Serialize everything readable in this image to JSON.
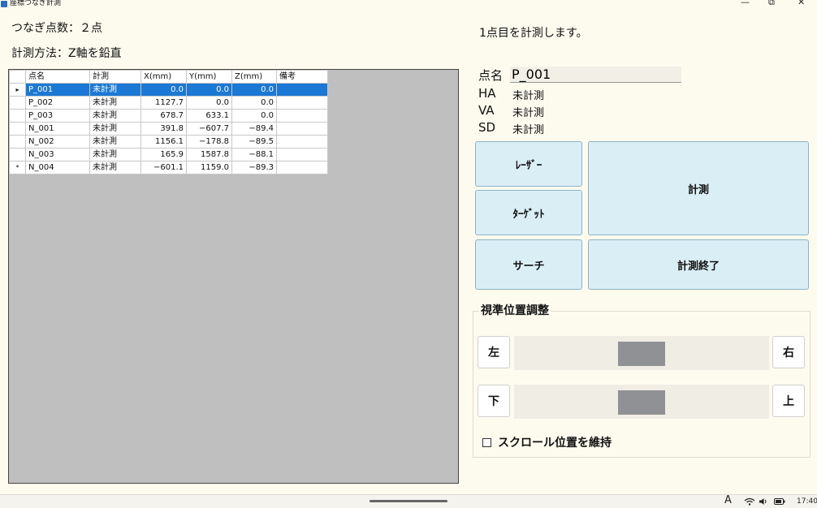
{
  "window": {
    "title": "座標つなぎ計測",
    "minimize": "—",
    "maximize": "⧉",
    "close": "✕"
  },
  "info": {
    "count_text": "つなぎ点数：２点",
    "method_text": "計測方法：Z軸を鉛直"
  },
  "status": "1点目を計測します。",
  "grid": {
    "columns": [
      "点名",
      "計測",
      "X(mm)",
      "Y(mm)",
      "Z(mm)",
      "備考"
    ],
    "rows": [
      {
        "marker": "▸",
        "name": "P_001",
        "state": "未計測",
        "x": "0.0",
        "y": "0.0",
        "z": "0.0",
        "note": ""
      },
      {
        "marker": "",
        "name": "P_002",
        "state": "未計測",
        "x": "1127.7",
        "y": "0.0",
        "z": "0.0",
        "note": ""
      },
      {
        "marker": "",
        "name": "P_003",
        "state": "未計測",
        "x": "678.7",
        "y": "633.1",
        "z": "0.0",
        "note": ""
      },
      {
        "marker": "",
        "name": "N_001",
        "state": "未計測",
        "x": "391.8",
        "y": "−607.7",
        "z": "−89.4",
        "note": ""
      },
      {
        "marker": "",
        "name": "N_002",
        "state": "未計測",
        "x": "1156.1",
        "y": "−178.8",
        "z": "−89.5",
        "note": ""
      },
      {
        "marker": "",
        "name": "N_003",
        "state": "未計測",
        "x": "165.9",
        "y": "1587.8",
        "z": "−88.1",
        "note": ""
      },
      {
        "marker": "*",
        "name": "N_004",
        "state": "未計測",
        "x": "−601.1",
        "y": "1159.0",
        "z": "−89.3",
        "note": ""
      }
    ]
  },
  "point": {
    "name_label": "点名",
    "name_value": "P_001",
    "ha_label": "HA",
    "ha_value": "未計測",
    "va_label": "VA",
    "va_value": "未計測",
    "sd_label": "SD",
    "sd_value": "未計測"
  },
  "buttons": {
    "laser": "ﾚｰｻﾞｰ",
    "target": "ﾀｰｹﾞｯﾄ",
    "search": "サーチ",
    "measure": "計測",
    "finish": "計測終了"
  },
  "aim": {
    "title": "視準位置調整",
    "left": "左",
    "right": "右",
    "down": "下",
    "up": "上",
    "h_position": 0.5,
    "v_position": 0.5
  },
  "keep_scroll": {
    "label": "スクロール位置を維持",
    "checked": false
  },
  "taskbar": {
    "ime": "A",
    "wifi_icon": "wifi-icon",
    "volume_icon": "volume-icon",
    "battery_icon": "battery-icon",
    "time": "17:40"
  }
}
